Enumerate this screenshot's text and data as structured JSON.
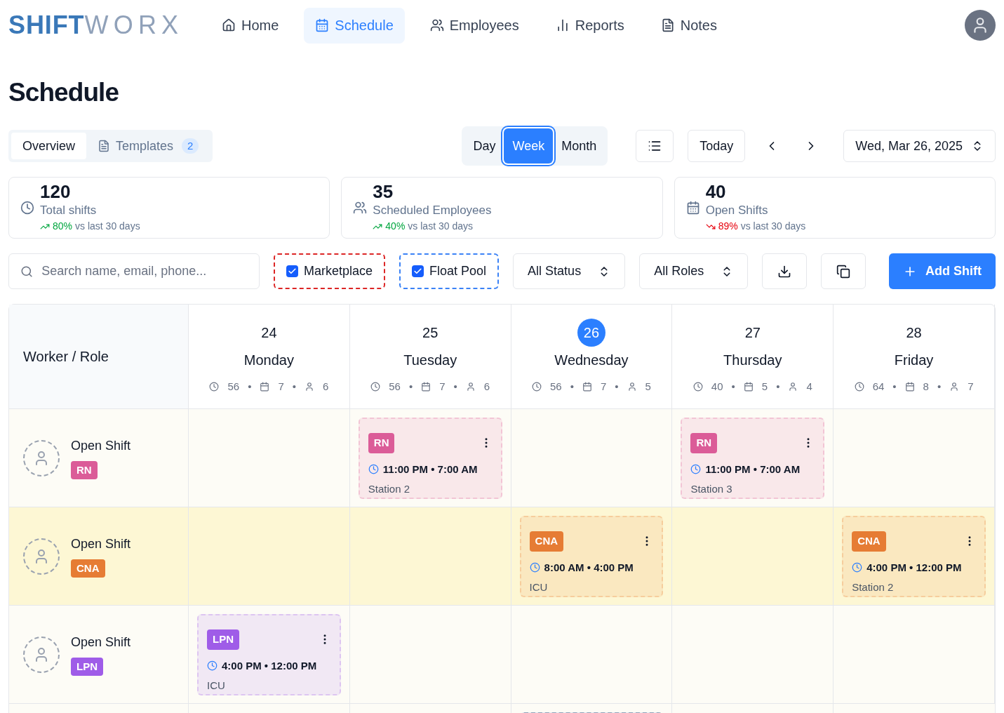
{
  "logo": {
    "bold": "SHIFT",
    "light": "WORX"
  },
  "nav": [
    {
      "label": "Home",
      "selected": false
    },
    {
      "label": "Schedule",
      "selected": true
    },
    {
      "label": "Employees",
      "selected": false
    },
    {
      "label": "Reports",
      "selected": false
    },
    {
      "label": "Notes",
      "selected": false
    }
  ],
  "page_title": "Schedule",
  "tabs": [
    {
      "label": "Overview",
      "selected": true
    },
    {
      "label": "Templates",
      "badge": "2",
      "selected": false
    }
  ],
  "views": [
    {
      "label": "Day",
      "selected": false
    },
    {
      "label": "Week",
      "selected": true
    },
    {
      "label": "Month",
      "selected": false
    }
  ],
  "today_button": "Today",
  "date_picker": "Wed, Mar 26, 2025",
  "stats": [
    {
      "value": "120",
      "label": "Total shifts",
      "kind": "up",
      "change": "80%",
      "note": "vs last 30 days"
    },
    {
      "value": "35",
      "label": "Scheduled Employees",
      "kind": "up",
      "change": "40%",
      "note": "vs last 30 days"
    },
    {
      "value": "40",
      "label": "Open Shifts",
      "kind": "down",
      "change": "89%",
      "note": "vs last 30 days"
    }
  ],
  "search": {
    "placeholder": "Search name, email, phone..."
  },
  "filters": [
    {
      "label": "Marketplace",
      "checked": true,
      "color": "#dc2626"
    },
    {
      "label": "Float Pool",
      "checked": true,
      "color": "#3b82f6"
    }
  ],
  "selects": [
    "All Status",
    "All Roles"
  ],
  "add_button": "Add Shift",
  "grid": {
    "corner": "Worker / Role",
    "days": [
      {
        "date": "24",
        "name": "Monday",
        "hours": "56",
        "sep1": "•",
        "shifts": "7",
        "sep2": "•",
        "people": "6",
        "selected": false
      },
      {
        "date": "25",
        "name": "Tuesday",
        "hours": "56",
        "sep1": "•",
        "shifts": "7",
        "sep2": "•",
        "people": "6",
        "selected": false
      },
      {
        "date": "26",
        "name": "Wednesday",
        "hours": "56",
        "sep1": "•",
        "shifts": "7",
        "sep2": "•",
        "people": "5",
        "selected": true
      },
      {
        "date": "27",
        "name": "Thursday",
        "hours": "40",
        "sep1": "•",
        "shifts": "5",
        "sep2": "•",
        "people": "4",
        "selected": false
      },
      {
        "date": "28",
        "name": "Friday",
        "hours": "64",
        "sep1": "•",
        "shifts": "8",
        "sep2": "•",
        "people": "7",
        "selected": false
      }
    ],
    "rows": [
      {
        "name": "Open Shift",
        "role": "RN",
        "color": "#db5c98",
        "highlighted": false,
        "cells": [
          {},
          {
            "role": "RN",
            "time": "11:00 PM • 7:00 AM",
            "place": "Station 2"
          },
          {},
          {
            "role": "RN",
            "time": "11:00 PM • 7:00 AM",
            "place": "Station 3"
          },
          {}
        ]
      },
      {
        "name": "Open Shift",
        "role": "CNA",
        "color": "#e67c34",
        "highlighted": true,
        "cells": [
          {},
          {},
          {
            "role": "CNA",
            "time": "8:00 AM • 4:00 PM",
            "place": "ICU"
          },
          {},
          {
            "role": "CNA",
            "time": "4:00 PM • 12:00 PM",
            "place": "Station 2"
          }
        ]
      },
      {
        "name": "Open Shift",
        "role": "LPN",
        "color": "#9f5ce8",
        "highlighted": false,
        "cells": [
          {
            "role": "LPN",
            "time": "4:00 PM • 12:00 PM",
            "place": "ICU"
          },
          {},
          {},
          {},
          {}
        ]
      }
    ]
  }
}
